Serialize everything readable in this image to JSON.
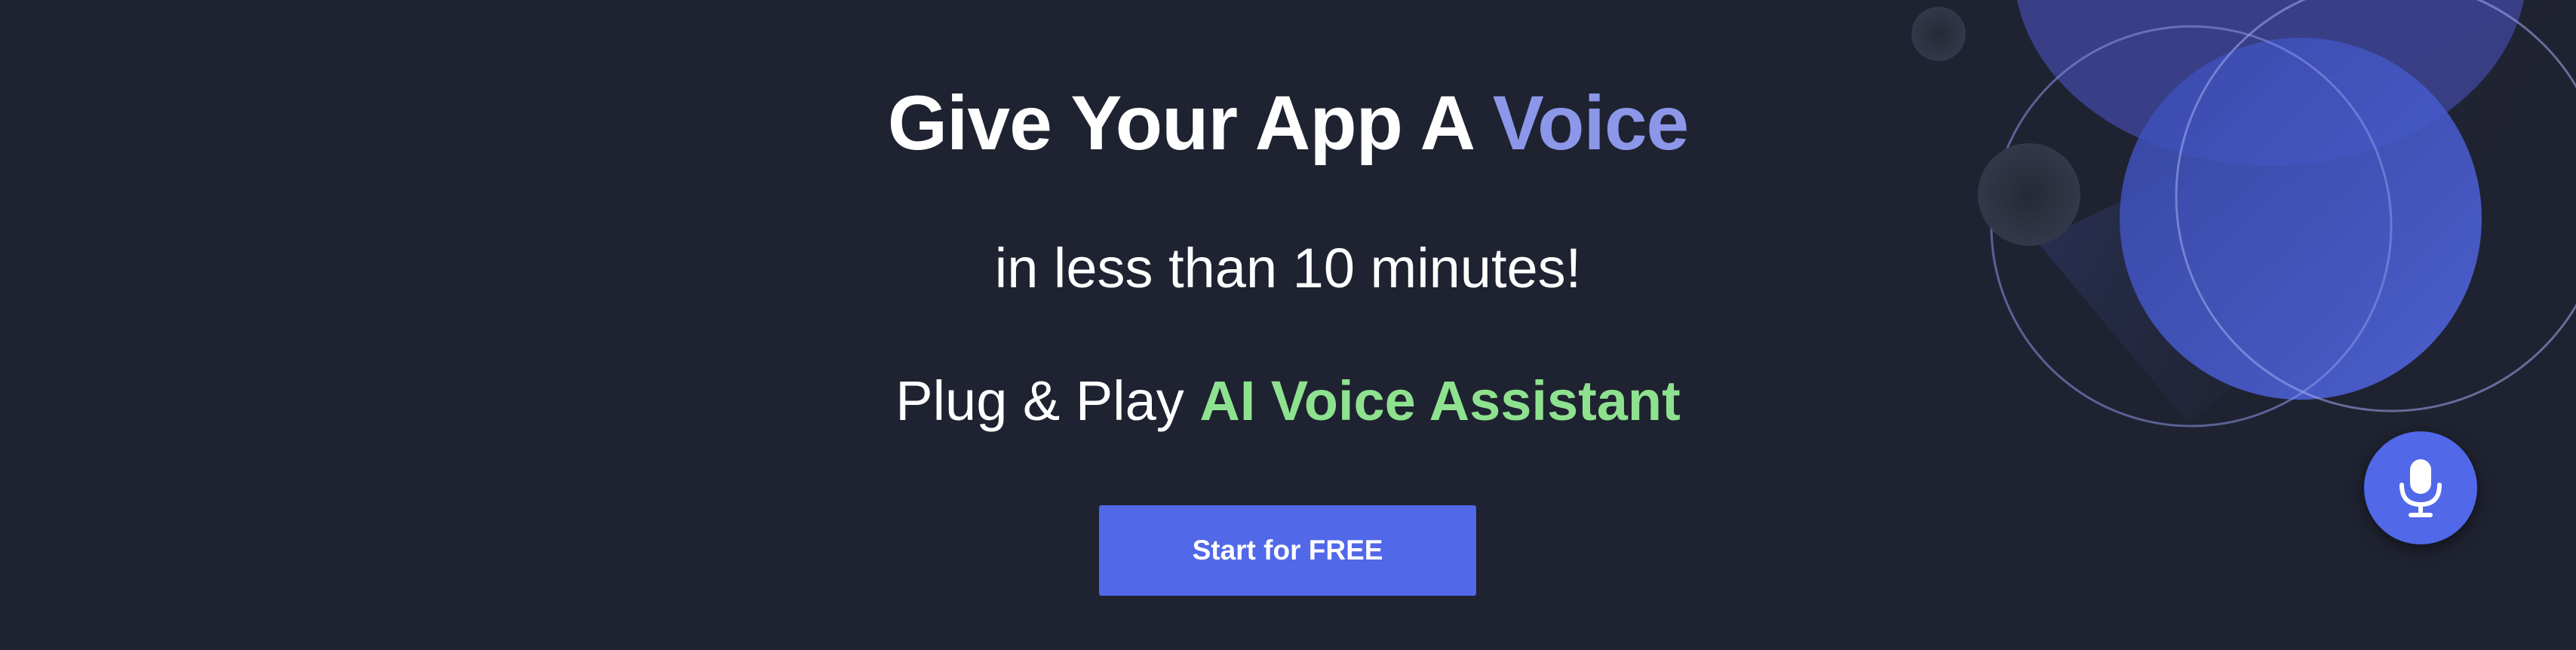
{
  "hero": {
    "headline_main": "Give Your App A ",
    "headline_accent": "Voice",
    "subline": "in less than 10 minutes!",
    "tagline_main": "Plug & Play ",
    "tagline_accent": "AI Voice Assistant",
    "cta_label": "Start for FREE"
  },
  "widget": {
    "icon": "microphone-icon"
  },
  "colors": {
    "background": "#1f2230",
    "accent_blue": "#8c97ea",
    "accent_green": "#8ee28f",
    "button": "#5168e9"
  }
}
